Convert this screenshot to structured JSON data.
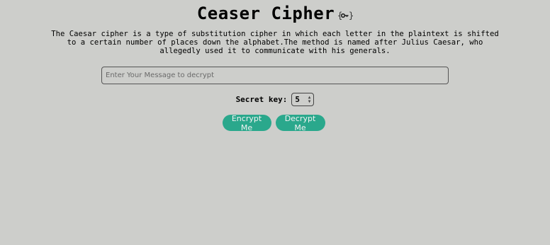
{
  "header": {
    "title": "Ceaser Cipher",
    "icon": "key-icon"
  },
  "description": "The Caesar cipher is a type of substitution cipher in which each letter in the plaintext is shifted to a certain number of places down the alphabet.The method is named after Julius Caesar, who allegedly used it to communicate with his generals.",
  "message_input": {
    "value": "",
    "placeholder": "Enter Your Message to decrypt"
  },
  "secret_key": {
    "label": "Secret key:",
    "value": "5"
  },
  "buttons": {
    "encrypt_label": "Encrypt Me",
    "decrypt_label": "Decrypt Me"
  },
  "colors": {
    "background": "#cdcecb",
    "button": "#2aa88c",
    "button_text": "#f2f2f2"
  }
}
